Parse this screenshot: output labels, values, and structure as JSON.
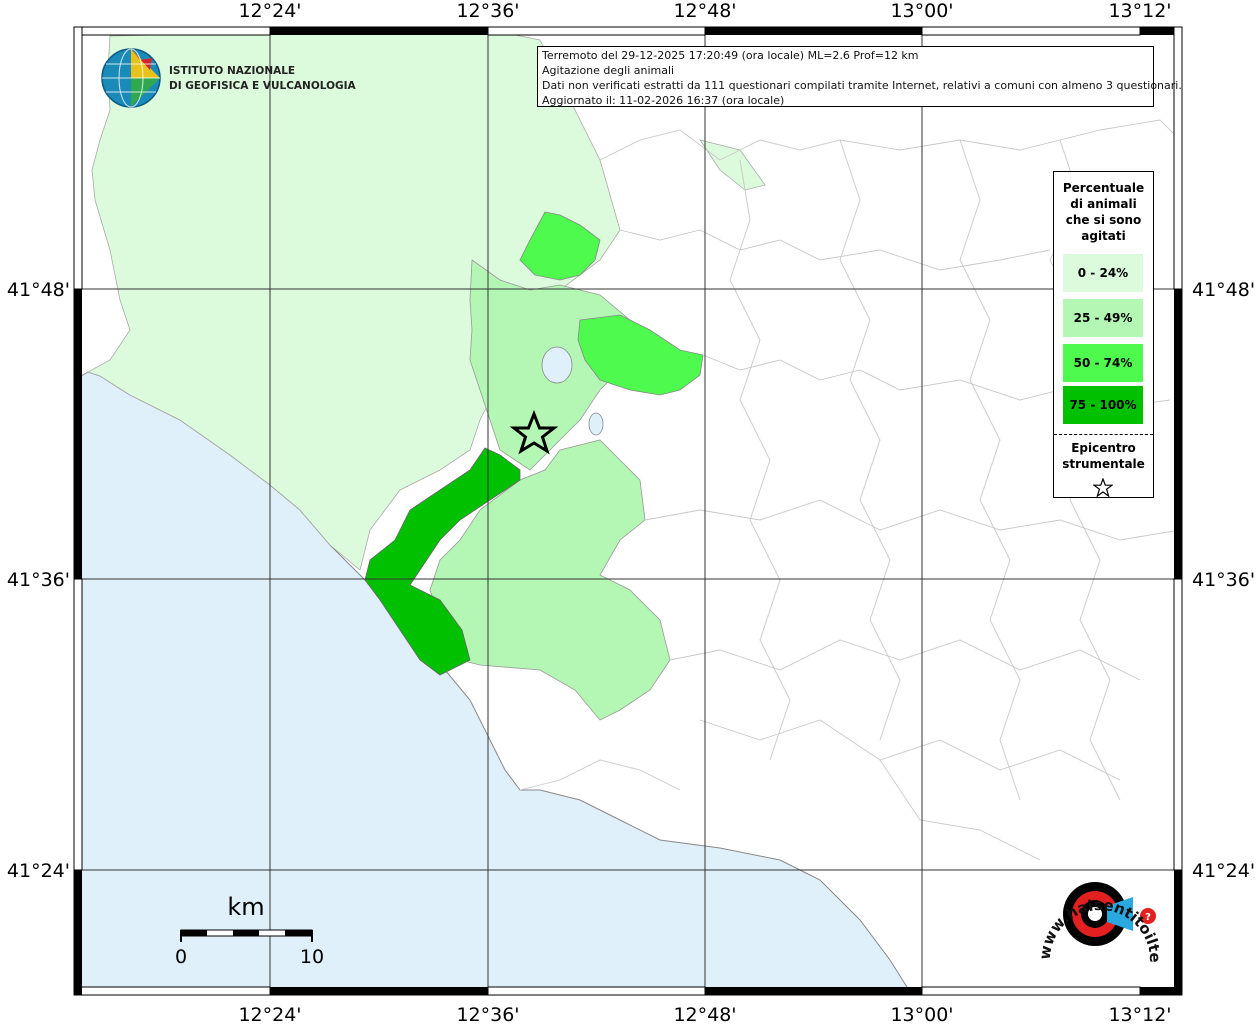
{
  "axis": {
    "top_ticks": [
      "12°24'",
      "12°36'",
      "12°48'",
      "13°00'",
      "13°12'"
    ],
    "bottom_ticks": [
      "12°24'",
      "12°36'",
      "12°48'",
      "13°00'",
      "13°12'"
    ],
    "left_ticks": [
      "41°48'",
      "41°36'",
      "41°24'"
    ],
    "right_ticks": [
      "41°48'",
      "41°36'",
      "41°24'"
    ]
  },
  "logo": {
    "line1": "ISTITUTO NAZIONALE",
    "line2": "DI GEOFISICA E VULCANOLOGIA"
  },
  "info_box": {
    "line1": "Terremoto del 29-12-2025 17:20:49 (ora locale) ML=2.6 Prof=12 km",
    "line2": "Agitazione degli animali",
    "line3": "Dati non verificati estratti da 111 questionari compilati tramite Internet, relativi a comuni con almeno 3 questionari.",
    "line4": "Aggiornato il: 11-02-2026 16:37 (ora locale)"
  },
  "legend": {
    "title_line1": "Percentuale",
    "title_line2": "di animali",
    "title_line3": "che si sono",
    "title_line4": "agitati",
    "items": [
      {
        "label": "0 - 24%",
        "color": "#dcfadc"
      },
      {
        "label": "25 - 49%",
        "color": "#b4f7b4"
      },
      {
        "label": "50 - 74%",
        "color": "#4dfa4d"
      },
      {
        "label": "75 - 100%",
        "color": "#00c000"
      }
    ],
    "epicenter_line1": "Epicentro",
    "epicenter_line2": "strumentale"
  },
  "scale_bar": {
    "unit": "km",
    "start": "0",
    "end": "10"
  },
  "watermark": {
    "text": "www.haisentitoilterremoto.it"
  },
  "colors": {
    "sea": "#dff0fb",
    "land": "#ffffff",
    "lake": "#dff0fb",
    "border": "#c8c8c8"
  }
}
